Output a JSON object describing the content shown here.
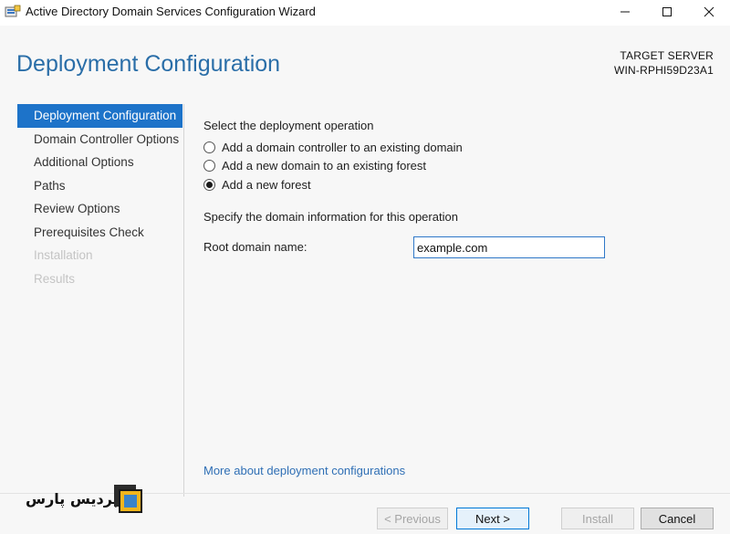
{
  "window": {
    "title": "Active Directory Domain Services Configuration Wizard",
    "controls": {
      "minimize": "—",
      "maximize": "☐",
      "close": "✕"
    }
  },
  "header": {
    "heading": "Deployment Configuration",
    "target_label": "TARGET SERVER",
    "target_name": "WIN-RPHI59D23A1"
  },
  "nav": {
    "items": [
      {
        "label": "Deployment Configuration",
        "state": "active"
      },
      {
        "label": "Domain Controller Options",
        "state": "normal"
      },
      {
        "label": "Additional Options",
        "state": "normal"
      },
      {
        "label": "Paths",
        "state": "normal"
      },
      {
        "label": "Review Options",
        "state": "normal"
      },
      {
        "label": "Prerequisites Check",
        "state": "normal"
      },
      {
        "label": "Installation",
        "state": "disabled"
      },
      {
        "label": "Results",
        "state": "disabled"
      }
    ]
  },
  "content": {
    "operation_label": "Select the deployment operation",
    "options": [
      {
        "label": "Add a domain controller to an existing domain",
        "selected": false
      },
      {
        "label": "Add a new domain to an existing forest",
        "selected": false
      },
      {
        "label": "Add a new forest",
        "selected": true
      }
    ],
    "domain_info_label": "Specify the domain information for this operation",
    "root_domain_label": "Root domain name:",
    "root_domain_value": "example.com",
    "more_link": "More about deployment configurations"
  },
  "footer": {
    "logo_text": "پردیس پارس",
    "buttons": {
      "previous": "< Previous",
      "next": "Next >",
      "install": "Install",
      "cancel": "Cancel"
    }
  },
  "colors": {
    "accent": "#1d73c9",
    "heading": "#2a6ea8",
    "link": "#2f6fb5",
    "disabled_text": "#c4c4c4"
  }
}
